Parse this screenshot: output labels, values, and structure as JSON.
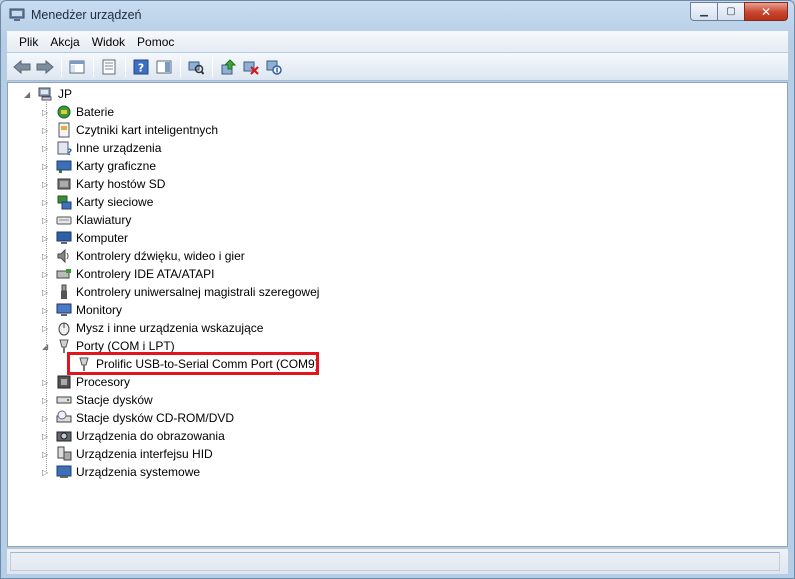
{
  "window": {
    "title": "Menedżer urządzeń"
  },
  "menu": [
    {
      "label": "Plik"
    },
    {
      "label": "Akcja"
    },
    {
      "label": "Widok"
    },
    {
      "label": "Pomoc"
    }
  ],
  "toolbar": [
    {
      "icon": "back-arrow-icon"
    },
    {
      "icon": "forward-arrow-icon"
    },
    {
      "icon": "show-hide-console-tree-icon"
    },
    {
      "icon": "properties-icon"
    },
    {
      "icon": "help-icon"
    },
    {
      "icon": "scan-hardware-icon"
    },
    {
      "icon": "update-driver-icon"
    },
    {
      "icon": "uninstall-icon"
    },
    {
      "icon": "disable-device-icon"
    }
  ],
  "tree": {
    "root": {
      "label": "JP",
      "icon": "computer-icon",
      "expanded": true
    },
    "categories": [
      {
        "label": "Baterie",
        "icon": "battery-icon"
      },
      {
        "label": "Czytniki kart inteligentnych",
        "icon": "smart-card-reader-icon"
      },
      {
        "label": "Inne urządzenia",
        "icon": "unknown-device-icon"
      },
      {
        "label": "Karty graficzne",
        "icon": "display-adapter-icon"
      },
      {
        "label": "Karty hostów SD",
        "icon": "sd-host-icon"
      },
      {
        "label": "Karty sieciowe",
        "icon": "network-adapter-icon"
      },
      {
        "label": "Klawiatury",
        "icon": "keyboard-icon"
      },
      {
        "label": "Komputer",
        "icon": "computer-monitor-icon"
      },
      {
        "label": "Kontrolery dźwięku, wideo i gier",
        "icon": "speaker-icon"
      },
      {
        "label": "Kontrolery IDE ATA/ATAPI",
        "icon": "ide-controller-icon"
      },
      {
        "label": "Kontrolery uniwersalnej magistrali szeregowej",
        "icon": "usb-icon"
      },
      {
        "label": "Monitory",
        "icon": "monitor-icon"
      },
      {
        "label": "Mysz i inne urządzenia wskazujące",
        "icon": "mouse-icon"
      },
      {
        "label": "Porty (COM i LPT)",
        "icon": "port-icon",
        "expanded": true,
        "children": [
          {
            "label": "Prolific USB-to-Serial Comm Port (COM9)",
            "icon": "port-icon"
          }
        ]
      },
      {
        "label": "Procesory",
        "icon": "processor-icon"
      },
      {
        "label": "Stacje dysków",
        "icon": "disk-drive-icon"
      },
      {
        "label": "Stacje dysków CD-ROM/DVD",
        "icon": "cdrom-icon"
      },
      {
        "label": "Urządzenia do obrazowania",
        "icon": "imaging-device-icon"
      },
      {
        "label": "Urządzenia interfejsu HID",
        "icon": "hid-icon"
      },
      {
        "label": "Urządzenia systemowe",
        "icon": "system-device-icon"
      }
    ]
  },
  "colors": {
    "highlight_border": "#e4141c",
    "title_bar": "#b9d1ea"
  }
}
